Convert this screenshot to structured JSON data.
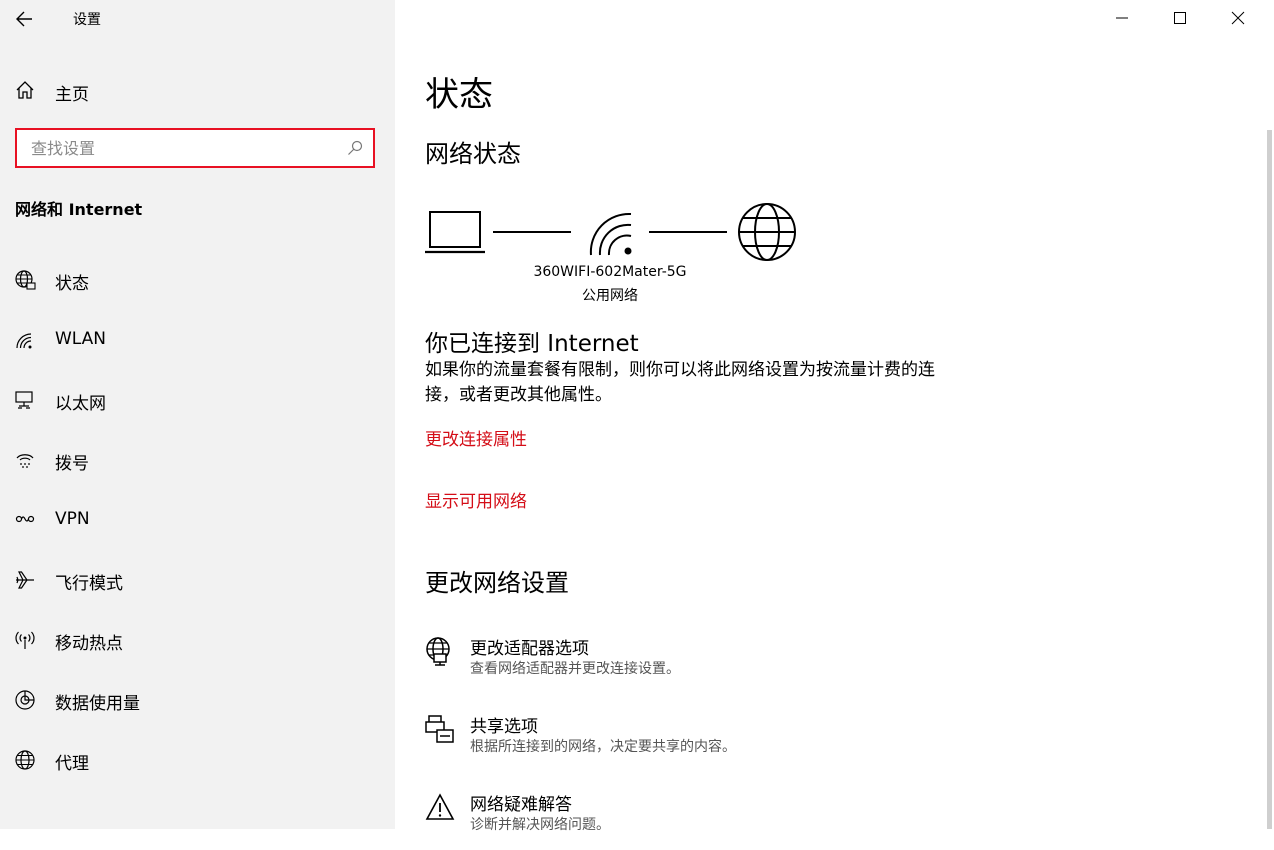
{
  "window": {
    "title": "设置",
    "controls": {
      "minimize": "minimize-icon",
      "maximize": "maximize-icon",
      "close": "close-icon"
    }
  },
  "sidebar": {
    "home_label": "主页",
    "search_placeholder": "查找设置",
    "section_title": "网络和 Internet",
    "items": [
      {
        "label": "状态",
        "icon": "globe-status-icon"
      },
      {
        "label": "WLAN",
        "icon": "wifi-icon"
      },
      {
        "label": "以太网",
        "icon": "ethernet-icon"
      },
      {
        "label": "拨号",
        "icon": "dialup-icon"
      },
      {
        "label": "VPN",
        "icon": "vpn-icon"
      },
      {
        "label": "飞行模式",
        "icon": "airplane-icon"
      },
      {
        "label": "移动热点",
        "icon": "hotspot-icon"
      },
      {
        "label": "数据使用量",
        "icon": "data-usage-icon"
      },
      {
        "label": "代理",
        "icon": "globe-icon"
      }
    ]
  },
  "main": {
    "title": "状态",
    "network_status_heading": "网络状态",
    "network_name": "360WIFI-602Mater-5G",
    "network_type": "公用网络",
    "connected_title": "你已连接到 Internet",
    "connected_desc": "如果你的流量套餐有限制，则你可以将此网络设置为按流量计费的连接，或者更改其他属性。",
    "link_change_props": "更改连接属性",
    "link_show_networks": "显示可用网络",
    "change_settings_heading": "更改网络设置",
    "options": [
      {
        "title": "更改适配器选项",
        "subtitle": "查看网络适配器并更改连接设置。",
        "icon": "adapter-icon"
      },
      {
        "title": "共享选项",
        "subtitle": "根据所连接到的网络，决定要共享的内容。",
        "icon": "sharing-icon"
      },
      {
        "title": "网络疑难解答",
        "subtitle": "诊断并解决网络问题。",
        "icon": "warning-icon"
      }
    ],
    "accent_color": "#d40d17"
  }
}
